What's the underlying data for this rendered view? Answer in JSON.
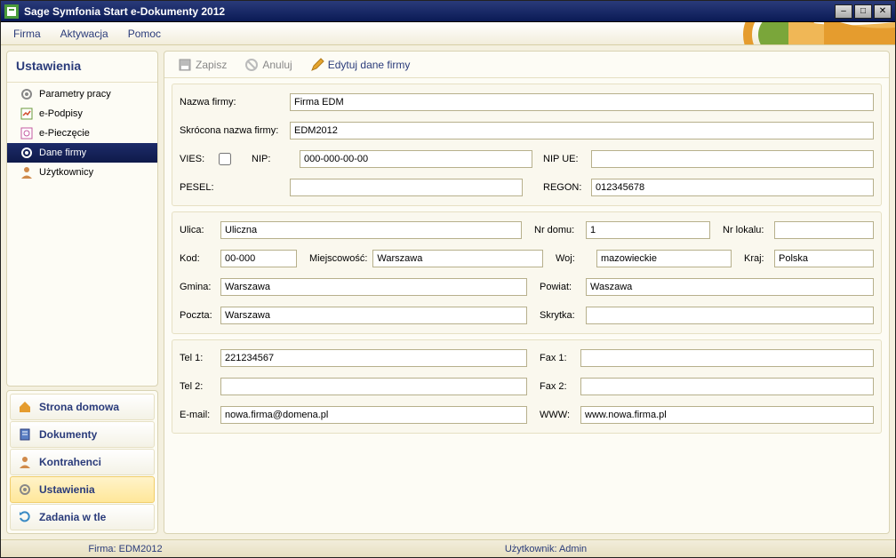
{
  "window": {
    "title": "Sage Symfonia Start e-Dokumenty 2012"
  },
  "menubar": {
    "items": [
      "Firma",
      "Aktywacja",
      "Pomoc"
    ]
  },
  "sidebar": {
    "header": "Ustawienia",
    "items": [
      {
        "label": "Parametry pracy"
      },
      {
        "label": "e-Podpisy"
      },
      {
        "label": "e-Pieczęcie"
      },
      {
        "label": "Dane firmy",
        "selected": true
      },
      {
        "label": "Użytkownicy"
      }
    ]
  },
  "nav": {
    "items": [
      {
        "label": "Strona domowa"
      },
      {
        "label": "Dokumenty"
      },
      {
        "label": "Kontrahenci"
      },
      {
        "label": "Ustawienia",
        "active": true
      },
      {
        "label": "Zadania w tle"
      }
    ]
  },
  "toolbar": {
    "save": "Zapisz",
    "cancel": "Anuluj",
    "edit": "Edytuj dane firmy"
  },
  "labels": {
    "nazwa_firmy": "Nazwa firmy:",
    "skrocona_nazwa": "Skrócona nazwa firmy:",
    "vies": "VIES:",
    "nip": "NIP:",
    "nip_ue": "NIP UE:",
    "pesel": "PESEL:",
    "regon": "REGON:",
    "ulica": "Ulica:",
    "nr_domu": "Nr domu:",
    "nr_lokalu": "Nr lokalu:",
    "kod": "Kod:",
    "miejscowosc": "Miejscowość:",
    "woj": "Woj:",
    "kraj": "Kraj:",
    "gmina": "Gmina:",
    "powiat": "Powiat:",
    "poczta": "Poczta:",
    "skrytka": "Skrytka:",
    "tel1": "Tel 1:",
    "fax1": "Fax 1:",
    "tel2": "Tel 2:",
    "fax2": "Fax 2:",
    "email": "E-mail:",
    "www": "WWW:"
  },
  "values": {
    "nazwa_firmy": "Firma EDM",
    "skrocona_nazwa": "EDM2012",
    "nip": "000-000-00-00",
    "nip_ue": "",
    "pesel": "",
    "regon": "012345678",
    "ulica": "Uliczna",
    "nr_domu": "1",
    "nr_lokalu": "",
    "kod": "00-000",
    "miejscowosc": "Warszawa",
    "woj": "mazowieckie",
    "kraj": "Polska",
    "gmina": "Warszawa",
    "powiat": "Waszawa",
    "poczta": "Warszawa",
    "skrytka": "",
    "tel1": "221234567",
    "fax1": "",
    "tel2": "",
    "fax2": "",
    "email": "nowa.firma@domena.pl",
    "www": "www.nowa.firma.pl"
  },
  "status": {
    "firma": "Firma: EDM2012",
    "user": "Użytkownik: Admin"
  }
}
